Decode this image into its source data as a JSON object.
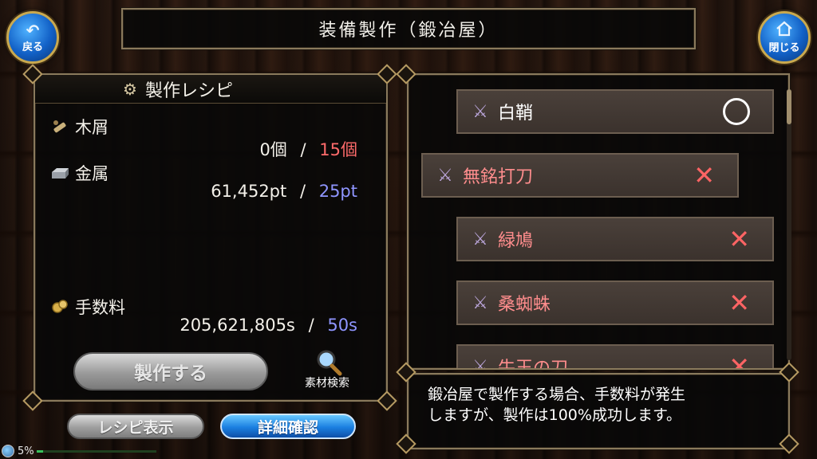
{
  "header": {
    "title": "装備製作（鍛冶屋）",
    "back_label": "戻る",
    "close_label": "閉じる"
  },
  "recipe": {
    "title": "製作レシピ",
    "materials": [
      {
        "name": "木屑",
        "icon": "wood-scrap-icon",
        "owned": "0個",
        "required": "15個",
        "required_color": "#ff6b6b"
      },
      {
        "name": "金属",
        "icon": "metal-ingot-icon",
        "owned": "61,452pt",
        "required": "25pt",
        "required_color": "#8f95ff"
      }
    ],
    "fee": {
      "name": "手数料",
      "icon": "coins-icon",
      "owned": "205,621,805s",
      "required": "50s",
      "required_color": "#8f95ff"
    },
    "separator": "/",
    "make_button": "製作する",
    "search_label": "素材検索"
  },
  "buttons": {
    "recipe_view": "レシピ表示",
    "detail_check": "詳細確認"
  },
  "weapons": [
    {
      "name": "白鞘",
      "status": "circle",
      "selected": false,
      "name_color": "white"
    },
    {
      "name": "無銘打刀",
      "status": "x",
      "selected": true,
      "name_color": "red"
    },
    {
      "name": "緑鳩",
      "status": "x",
      "selected": false,
      "name_color": "red"
    },
    {
      "name": "桑蜘蛛",
      "status": "x",
      "selected": false,
      "name_color": "red"
    },
    {
      "name": "牛王の刀",
      "status": "x",
      "selected": false,
      "name_color": "red"
    }
  ],
  "info": {
    "line1": "鍛冶屋で製作する場合、手数料が発生",
    "line2": "しますが、製作は100%成功します。"
  },
  "status": {
    "percent_label": "5%",
    "progress": 0.05
  },
  "colors": {
    "accent_blue": "#1b7fe0",
    "frame_gold": "#8a7a5c",
    "insufficient_red": "#ff6b6b",
    "sufficient_blue": "#8f95ff"
  }
}
